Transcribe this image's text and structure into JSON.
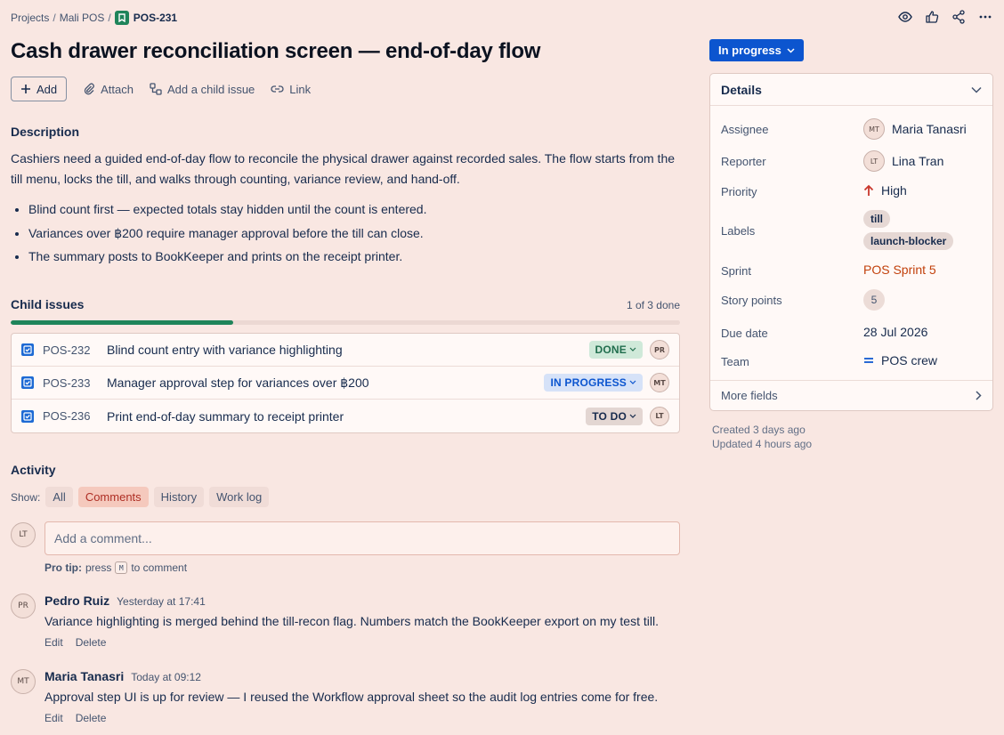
{
  "breadcrumb": {
    "items": [
      "Projects",
      "Mali POS"
    ],
    "issue_key": "POS-231"
  },
  "issue": {
    "title": "Cash drawer reconciliation screen — end-of-day flow",
    "status": "In progress"
  },
  "actions": {
    "add": "Add",
    "attach": "Attach",
    "child": "Add a child issue",
    "link": "Link"
  },
  "description": {
    "heading": "Description",
    "paragraph": "Cashiers need a guided end-of-day flow to reconcile the physical drawer against recorded sales. The flow starts from the till menu, locks the till, and walks through counting, variance review, and hand-off.",
    "bullets": [
      "Blind count first — expected totals stay hidden until the count is entered.",
      "Variances over ฿200 require manager approval before the till can close.",
      "The summary posts to BookKeeper and prints on the receipt printer."
    ]
  },
  "child_issues": {
    "heading": "Child issues",
    "count_text": "1 of 3 done",
    "progress_fraction": 0.333,
    "items": [
      {
        "key": "POS-232",
        "summary": "Blind count entry with variance highlighting",
        "status": "DONE",
        "assignee": "PR"
      },
      {
        "key": "POS-233",
        "summary": "Manager approval step for variances over ฿200",
        "status": "IN PROGRESS",
        "assignee": "MT"
      },
      {
        "key": "POS-236",
        "summary": "Print end-of-day summary to receipt printer",
        "status": "TO DO",
        "assignee": "LT"
      }
    ]
  },
  "activity": {
    "heading": "Activity",
    "show_label": "Show:",
    "tabs": [
      "All",
      "Comments",
      "History",
      "Work log"
    ],
    "active_tab": "Comments",
    "current_user": "LT",
    "comment_placeholder": "Add a comment...",
    "protip_label": "Pro tip:",
    "protip_pre": "press",
    "protip_key": "M",
    "protip_post": "to comment",
    "comments": [
      {
        "initials": "PR",
        "author": "Pedro Ruiz",
        "time": "Yesterday at 17:41",
        "body": "Variance highlighting is merged behind the till-recon flag. Numbers match the BookKeeper export on my test till.",
        "edit": "Edit",
        "delete": "Delete"
      },
      {
        "initials": "MT",
        "author": "Maria Tanasri",
        "time": "Today at 09:12",
        "body": "Approval step UI is up for review — I reused the Workflow approval sheet so the audit log entries come for free.",
        "edit": "Edit",
        "delete": "Delete"
      }
    ]
  },
  "details": {
    "heading": "Details",
    "assignee_label": "Assignee",
    "assignee_initials": "MT",
    "assignee": "Maria Tanasri",
    "reporter_label": "Reporter",
    "reporter_initials": "LT",
    "reporter": "Lina Tran",
    "priority_label": "Priority",
    "priority": "High",
    "labels_label": "Labels",
    "labels": [
      "till",
      "launch-blocker"
    ],
    "sprint_label": "Sprint",
    "sprint": "POS Sprint 5",
    "points_label": "Story points",
    "points": "5",
    "due_label": "Due date",
    "due": "28 Jul 2026",
    "team_label": "Team",
    "team": "POS crew",
    "more_fields": "More fields"
  },
  "meta": {
    "created": "Created 3 days ago",
    "updated": "Updated 4 hours ago"
  },
  "colors": {
    "accent": "#0c55cf",
    "done": "#1f845a",
    "background": "#f9e7e2"
  }
}
